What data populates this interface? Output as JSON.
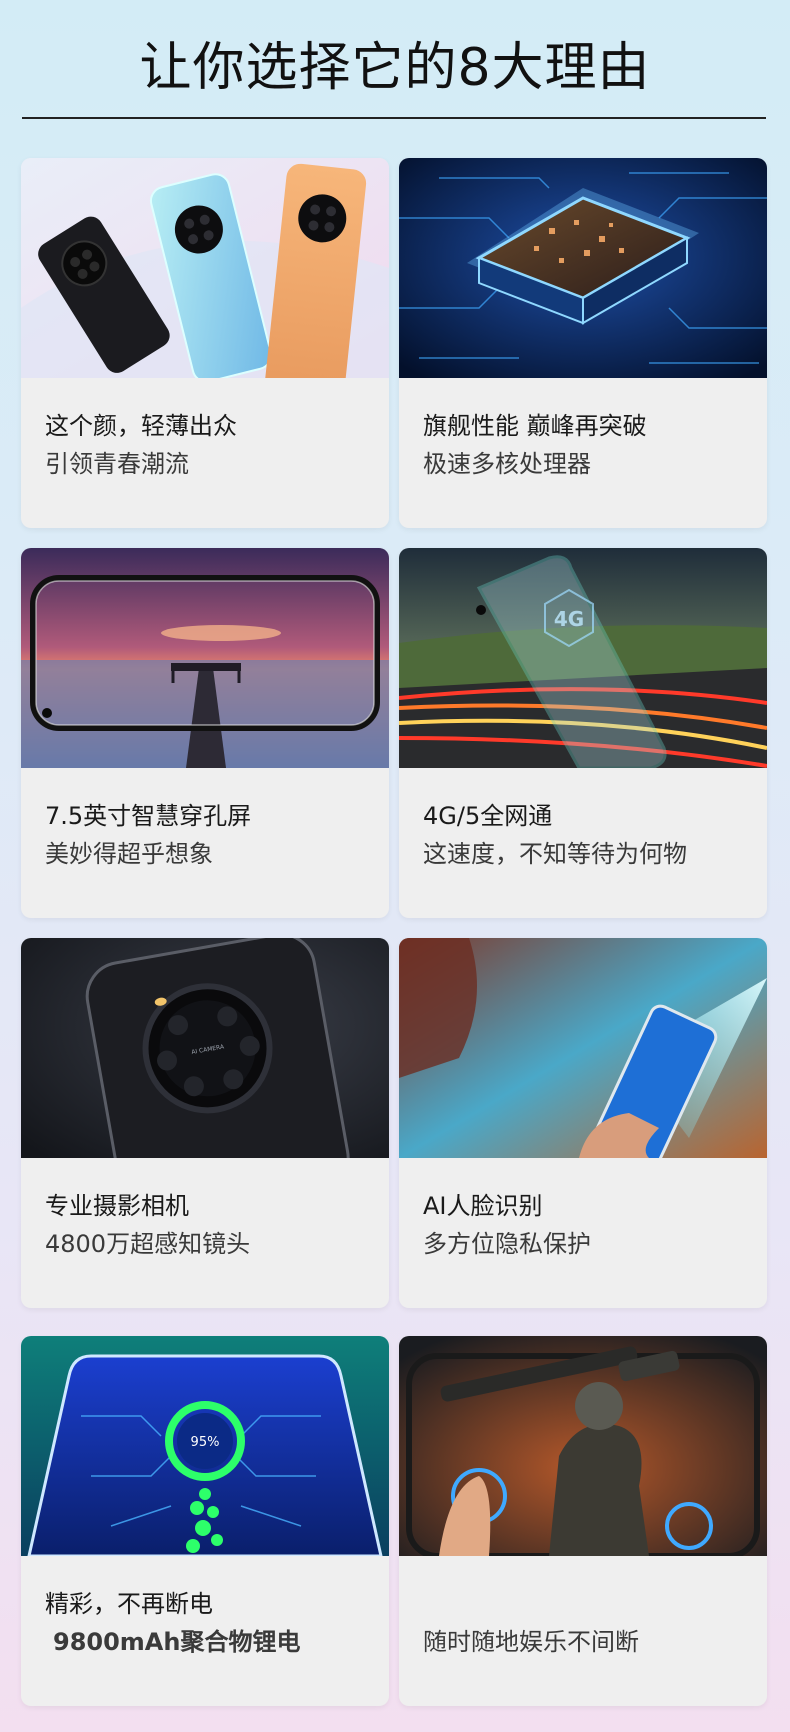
{
  "header": {
    "title": "让你选择它的8大理由"
  },
  "cards": [
    {
      "title": "这个颜，轻薄出众",
      "subtitle": "引领青春潮流"
    },
    {
      "title": "旗舰性能  巅峰再突破",
      "subtitle": "极速多核处理器"
    },
    {
      "title": "7.5英寸智慧穿孔屏",
      "subtitle": "美妙得超乎想象"
    },
    {
      "title": " 4G/5全网通",
      "subtitle": "这速度，不知等待为何物",
      "badge": "4G"
    },
    {
      "title": "专业摄影相机",
      "subtitle": "4800万超感知镜头",
      "badge": "AI CAMERA"
    },
    {
      "title": "AI人脸识别",
      "subtitle": "多方位隐私保护"
    },
    {
      "title": "精彩，不再断电",
      "subtitle": "9800mAh聚合物锂电",
      "badge": "95%"
    },
    {
      "title": "",
      "subtitle": "随时随地娱乐不间断"
    }
  ],
  "colors": {
    "page_top": "#d3ecf6",
    "page_bottom": "#f3dff0",
    "card_bg": "#efefef",
    "title_text": "#111111"
  }
}
